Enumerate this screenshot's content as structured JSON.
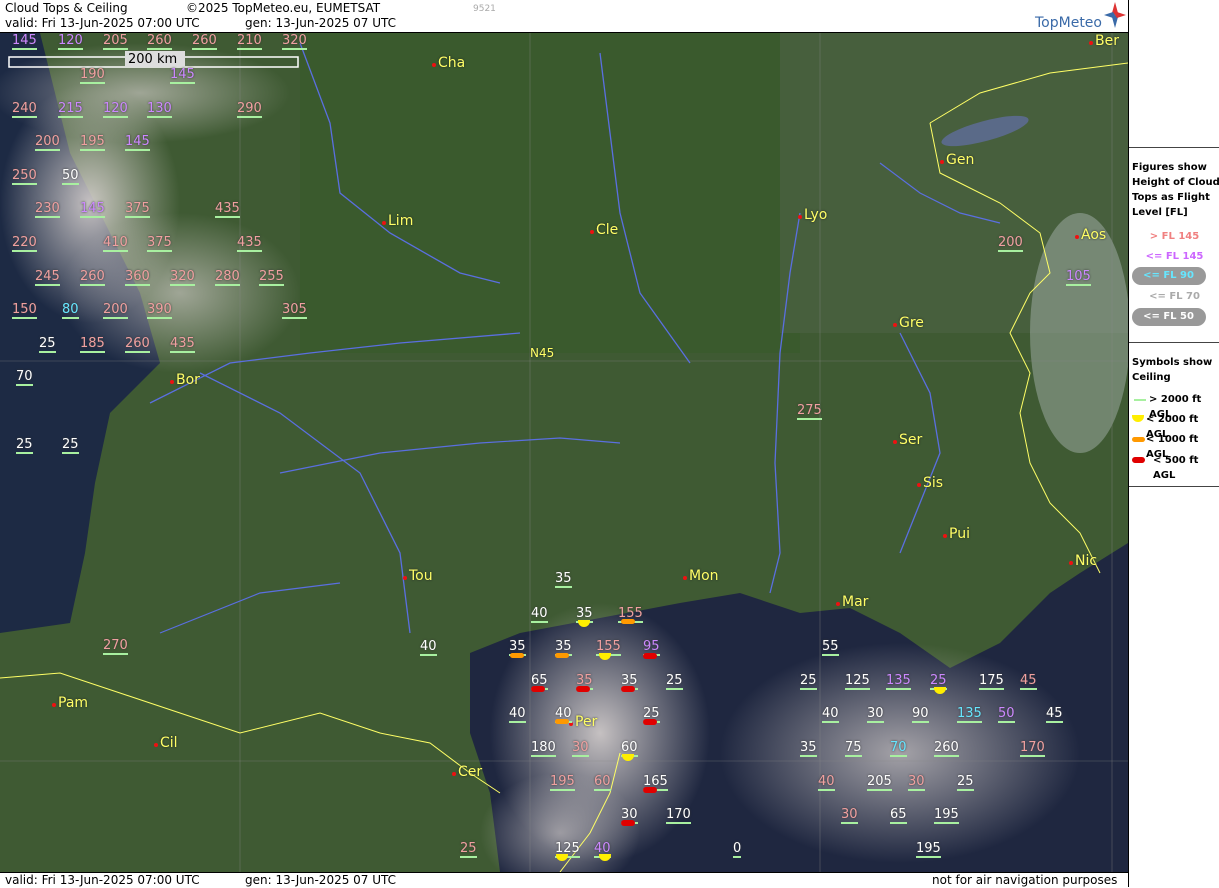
{
  "header": {
    "title": "Cloud Tops & Ceiling",
    "copyright": "©2025 TopMeteo.eu, EUMETSAT",
    "valid": "valid:  Fri  13-Jun-2025  07:00 UTC",
    "gen": "gen: 13-Jun-2025 07 UTC",
    "code": "9521",
    "logo": "TopMeteo"
  },
  "footer": {
    "valid": "valid:  Fri  13-Jun-2025  07:00 UTC",
    "gen": "gen: 13-Jun-2025 07 UTC",
    "disclaimer": "not for air navigation purposes"
  },
  "scale": {
    "label": "200 km"
  },
  "grid_label": "N45",
  "legend": {
    "tops_title": [
      "Figures show",
      "Height of Cloud",
      "Tops as Flight",
      "Level  [FL]"
    ],
    "tops": [
      {
        "label": "> FL 145",
        "color": "#f08080"
      },
      {
        "label": "<= FL 145",
        "color": "#cc66ff"
      },
      {
        "label": "<= FL 90",
        "color": "#66e6ff"
      },
      {
        "label": "<= FL 70",
        "color": "#aaaaaa"
      },
      {
        "label": "<= FL 50",
        "color": "#ffffff"
      }
    ],
    "ceiling_title": [
      "Symbols show",
      "Ceiling"
    ],
    "ceiling": [
      {
        "label": "> 2000 ft AGL",
        "symbol": "line"
      },
      {
        "label": "< 2000 ft AGL",
        "symbol": "yellow-half-circle"
      },
      {
        "label": "< 1000 ft AGL",
        "symbol": "orange-bar"
      },
      {
        "label": "< 500 ft AGL",
        "symbol": "red-bar"
      }
    ]
  },
  "cities": [
    "Cha",
    "Lim",
    "Cle",
    "Lyo",
    "Gen",
    "Ber",
    "Aos",
    "Gre",
    "Bor",
    "Ser",
    "Sis",
    "Pui",
    "Tou",
    "Mon",
    "Mar",
    "Nic",
    "Pam",
    "Cil",
    "Cer",
    "Per"
  ],
  "flight_levels": [
    "145",
    "120",
    "205",
    "260",
    "260",
    "210",
    "320",
    "190",
    "145",
    "240",
    "215",
    "120",
    "130",
    "290",
    "200",
    "195",
    "145",
    "250",
    "50",
    "230",
    "145",
    "375",
    "435",
    "220",
    "410",
    "375",
    "435",
    "245",
    "260",
    "360",
    "320",
    "280",
    "255",
    "150",
    "80",
    "200",
    "390",
    "305",
    "25",
    "185",
    "260",
    "435",
    "70",
    "25",
    "25",
    "270",
    "200",
    "105",
    "275",
    "35",
    "40",
    "35",
    "155",
    "35",
    "35",
    "155",
    "95",
    "55",
    "40",
    "65",
    "35",
    "35",
    "25",
    "25",
    "125",
    "135",
    "25",
    "175",
    "45",
    "40",
    "40",
    "25",
    "40",
    "30",
    "90",
    "135",
    "50",
    "45",
    "180",
    "30",
    "60",
    "35",
    "75",
    "70",
    "260",
    "170",
    "195",
    "60",
    "165",
    "40",
    "205",
    "30",
    "25",
    "30",
    "170",
    "30",
    "65",
    "195",
    "25",
    "125",
    "40",
    "0",
    "195"
  ]
}
